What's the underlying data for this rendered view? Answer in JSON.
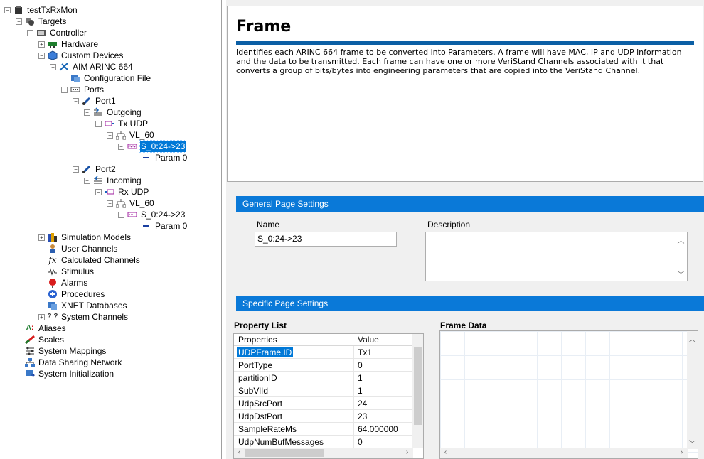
{
  "tree": {
    "root": "testTxRxMon",
    "targets": "Targets",
    "controller": "Controller",
    "hardware": "Hardware",
    "custom_devices": "Custom Devices",
    "aim_arinc": "AIM ARINC 664",
    "config_file": "Configuration File",
    "ports": "Ports",
    "port1": "Port1",
    "outgoing": "Outgoing",
    "tx_udp": "Tx UDP",
    "vl60_a": "VL_60",
    "frame_a": "S_0:24->23",
    "param_a": "Param 0",
    "port2": "Port2",
    "incoming": "Incoming",
    "rx_udp": "Rx UDP",
    "vl60_b": "VL_60",
    "frame_b": "S_0:24->23",
    "param_b": "Param 0",
    "sim_models": "Simulation Models",
    "user_channels": "User Channels",
    "calc_channels": "Calculated Channels",
    "stimulus": "Stimulus",
    "alarms": "Alarms",
    "procedures": "Procedures",
    "xnet": "XNET Databases",
    "system_channels": "System Channels",
    "aliases": "Aliases",
    "scales": "Scales",
    "system_mappings": "System Mappings",
    "data_sharing": "Data Sharing Network",
    "system_init": "System Initialization"
  },
  "help": {
    "title": "Frame",
    "description": "Identifies each ARINC 664 frame to be converted into Parameters. A frame will have MAC, IP and UDP information and the data to be transmitted. Each frame can have one or more VeriStand Channels associated with it that converts a group of bits/bytes into engineering parameters that are copied into the VeriStand Channel."
  },
  "general": {
    "section_label": "General Page Settings",
    "name_label": "Name",
    "name_value": "S_0:24->23",
    "description_label": "Description",
    "description_value": ""
  },
  "specific": {
    "section_label": "Specific Page Settings",
    "property_list_label": "Property List",
    "frame_data_label": "Frame Data",
    "col_properties": "Properties",
    "col_value": "Value",
    "rows": [
      {
        "k": "UDPFrame.ID",
        "v": "Tx1"
      },
      {
        "k": "PortType",
        "v": "0"
      },
      {
        "k": "partitionID",
        "v": "1"
      },
      {
        "k": "SubVlId",
        "v": "1"
      },
      {
        "k": "UdpSrcPort",
        "v": "24"
      },
      {
        "k": "UdpDstPort",
        "v": "23"
      },
      {
        "k": "SampleRateMs",
        "v": "64.000000"
      },
      {
        "k": "UdpNumBufMessages",
        "v": "0"
      }
    ]
  }
}
